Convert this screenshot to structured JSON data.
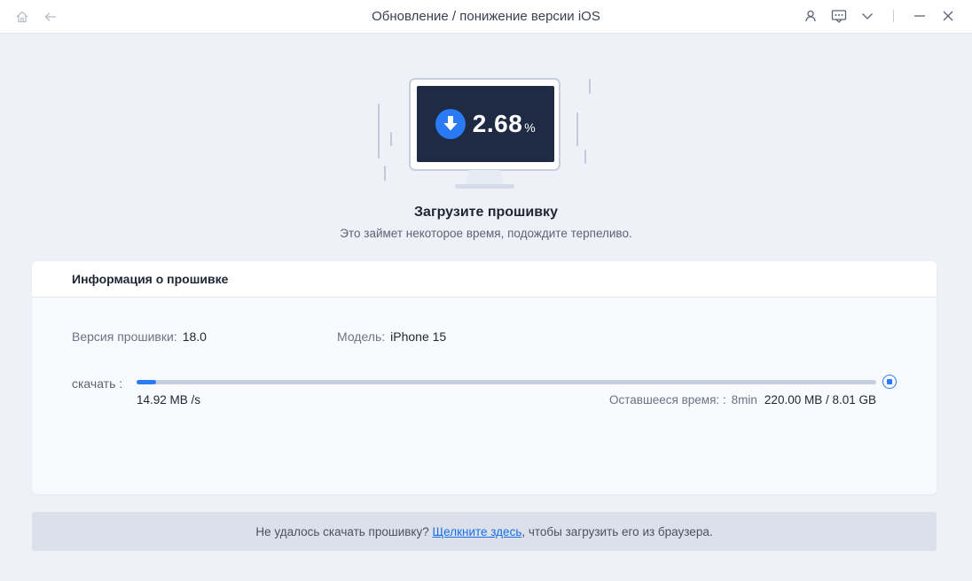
{
  "window": {
    "title": "Обновление / понижение версии iOS"
  },
  "titlebar": {
    "icons": [
      "home-icon",
      "back-arrow-icon",
      "user-icon",
      "feedback-icon",
      "chevron-down-icon",
      "minimize-icon",
      "close-icon"
    ]
  },
  "progress_display": {
    "value": "2.68",
    "unit": "%"
  },
  "hero": {
    "title": "Загрузите прошивку",
    "subtitle": "Это займет некоторое время, подождите терпеливо."
  },
  "firmware_card": {
    "heading": "Информация о прошивке",
    "version_label": "Версия прошивки:",
    "version_value": "18.0",
    "model_label": "Модель:",
    "model_value": "iPhone 15",
    "download_label": "скачать :",
    "progress_fraction": 0.0268,
    "speed": "14.92 MB /s",
    "remaining_label": "Оставшееся время:  :",
    "remaining_value": "8min",
    "size_progress": "220.00 MB / 8.01 GB"
  },
  "footer": {
    "text_before": "Не удалось скачать прошивку? ",
    "link": "Щелкните здесь",
    "text_after": ", чтобы загрузить его из браузера."
  },
  "colors": {
    "accent": "#2a7bf3",
    "screen": "#1f2a44",
    "background": "#eef1f8"
  }
}
